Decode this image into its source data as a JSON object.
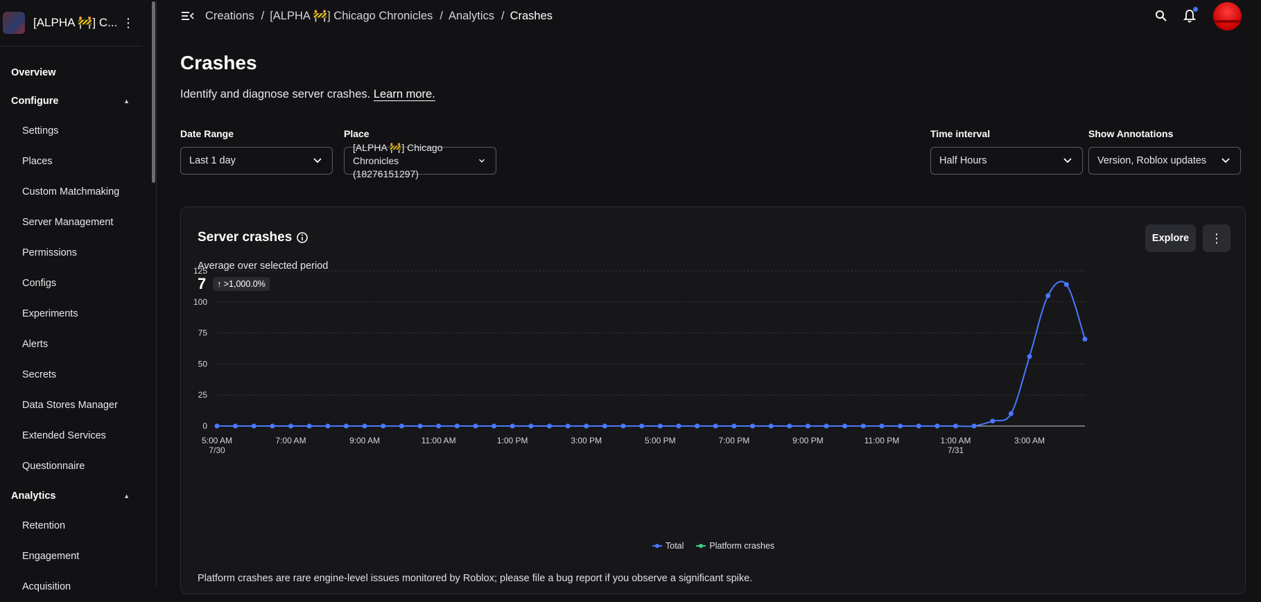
{
  "sidebar": {
    "experience_title": "[ALPHA 🚧] C...",
    "top_item": "Overview",
    "sections": [
      {
        "label": "Configure",
        "items": [
          "Settings",
          "Places",
          "Custom Matchmaking",
          "Server Management",
          "Permissions",
          "Configs",
          "Experiments",
          "Alerts",
          "Secrets",
          "Data Stores Manager",
          "Extended Services",
          "Questionnaire"
        ]
      },
      {
        "label": "Analytics",
        "items": [
          "Retention",
          "Engagement",
          "Acquisition"
        ]
      }
    ]
  },
  "breadcrumb": [
    "Creations",
    "[ALPHA 🚧] Chicago Chronicles",
    "Analytics",
    "Crashes"
  ],
  "page": {
    "title": "Crashes",
    "description": "Identify and diagnose server crashes.",
    "learn_more": "Learn more."
  },
  "filters": {
    "date_range": {
      "label": "Date Range",
      "value": "Last 1 day"
    },
    "place": {
      "label": "Place",
      "value": "[ALPHA 🚧] Chicago Chronicles (18276151297)"
    },
    "time_interval": {
      "label": "Time interval",
      "value": "Half Hours"
    },
    "annotations": {
      "label": "Show Annotations",
      "value": "Version, Roblox updates"
    }
  },
  "card": {
    "title": "Server crashes",
    "explore_label": "Explore",
    "avg_label": "Average over selected period",
    "avg_value": "7",
    "delta": "↑ >1,000.0%",
    "footnote": "Platform crashes are rare engine-level issues monitored by Roblox; please file a bug report if you observe a significant spike."
  },
  "colors": {
    "total": "#4a78ff",
    "platform": "#3ad18c",
    "accent": "#3f74ff"
  },
  "chart_data": {
    "type": "line",
    "title": "",
    "xlabel": "",
    "ylabel": "",
    "ylim": [
      0,
      125
    ],
    "yticks": [
      0,
      25,
      50,
      75,
      100,
      125
    ],
    "x_tick_labels": [
      [
        "5:00 AM",
        "7/30"
      ],
      [
        "7:00 AM",
        ""
      ],
      [
        "9:00 AM",
        ""
      ],
      [
        "11:00 AM",
        ""
      ],
      [
        "1:00 PM",
        ""
      ],
      [
        "3:00 PM",
        ""
      ],
      [
        "5:00 PM",
        ""
      ],
      [
        "7:00 PM",
        ""
      ],
      [
        "9:00 PM",
        ""
      ],
      [
        "11:00 PM",
        ""
      ],
      [
        "1:00 AM",
        "7/31"
      ],
      [
        "3:00 AM",
        ""
      ]
    ],
    "x_tick_index": [
      0,
      4,
      8,
      12,
      16,
      20,
      24,
      28,
      32,
      36,
      40,
      44
    ],
    "series": [
      {
        "name": "Total",
        "values": [
          0,
          0,
          0,
          0,
          0,
          0,
          0,
          0,
          0,
          0,
          0,
          0,
          0,
          0,
          0,
          0,
          0,
          0,
          0,
          0,
          0,
          0,
          0,
          0,
          0,
          0,
          0,
          0,
          0,
          0,
          0,
          0,
          0,
          0,
          0,
          0,
          0,
          0,
          0,
          0,
          0,
          0,
          4,
          10,
          56,
          105,
          114,
          70
        ]
      },
      {
        "name": "Platform crashes",
        "values": []
      }
    ],
    "grid": true,
    "legend_position": "bottom"
  }
}
